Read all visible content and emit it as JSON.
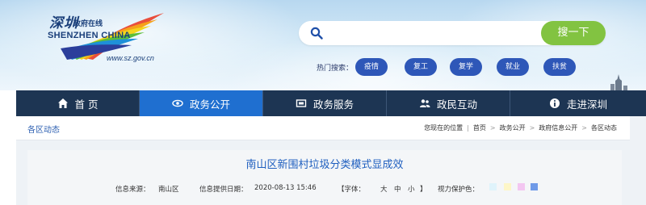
{
  "header": {
    "logo": {
      "cn_title": "深圳",
      "cn_sub": "政府在线",
      "en_title": "SHENZHEN CHINA",
      "url": "www.sz.gov.cn"
    },
    "search": {
      "placeholder": "",
      "value": "",
      "button_label": "搜一下",
      "button_color": "#82c341"
    },
    "hot_search": {
      "label": "热门搜索：",
      "tags": [
        "疫情",
        "复工",
        "复学",
        "就业",
        "扶贫"
      ]
    }
  },
  "nav": {
    "items": [
      {
        "label": "首 页",
        "icon": "home-icon"
      },
      {
        "label": "政务公开",
        "icon": "transparency-icon"
      },
      {
        "label": "政务服务",
        "icon": "service-icon"
      },
      {
        "label": "政民互动",
        "icon": "people-icon"
      },
      {
        "label": "走进深圳",
        "icon": "info-icon"
      }
    ],
    "active_index": 1,
    "bg_color": "#1d3553",
    "active_color": "#1f6fd0"
  },
  "breadcrumb": {
    "section_title": "各区动态",
    "prefix": "您现在的位置",
    "items": [
      "首页",
      "政务公开",
      "政府信息公开",
      "各区动态"
    ]
  },
  "article": {
    "title": "南山区新围村垃圾分类模式显成效",
    "source_label": "信息来源：",
    "source_value": "南山区",
    "date_label": "信息提供日期：",
    "date_value": "2020-08-13 15:46",
    "font_label": "【字体：",
    "font_sizes": [
      "大",
      "中",
      "小"
    ],
    "font_close": "】",
    "vision_label": "视力保护色：",
    "swatch_colors": [
      "#dff3fb",
      "#fdf6c8",
      "#f3c6f1",
      "#6f9ae8"
    ]
  }
}
